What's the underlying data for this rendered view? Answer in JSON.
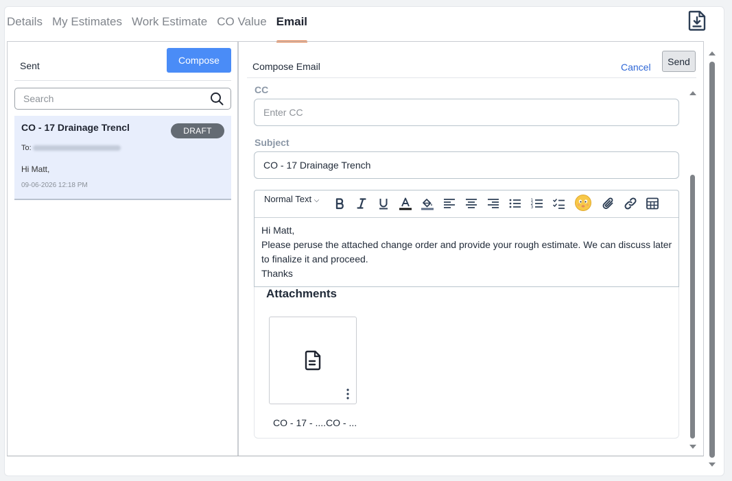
{
  "tabs": [
    {
      "label": "Details"
    },
    {
      "label": "My Estimates"
    },
    {
      "label": "Work Estimate"
    },
    {
      "label": "CO Value"
    },
    {
      "label": "Email",
      "active": true
    }
  ],
  "header": {
    "export_icon": "file-download-icon"
  },
  "left": {
    "sent_label": "Sent",
    "compose_label": "Compose",
    "search_placeholder": "Search",
    "emails": [
      {
        "subject": "CO - 17 Drainage Trencl",
        "badge": "DRAFT",
        "to_label": "To:",
        "body": "Hi Matt,",
        "date": "09-06-2026 12:18 PM"
      }
    ]
  },
  "compose": {
    "title": "Compose Email",
    "cancel_label": "Cancel",
    "send_label": "Send",
    "cc_label": "CC",
    "cc_placeholder": "Enter CC",
    "subject_label": "Subject",
    "subject_value": "CO - 17 Drainage Trench",
    "toolbar": {
      "format_label": "Normal Text",
      "items": [
        "bold-icon",
        "italic-icon",
        "underline-icon",
        "text-color-icon",
        "highlight-icon",
        "align-left-icon",
        "align-center-icon",
        "align-right-icon",
        "bullet-list-icon",
        "numbered-list-icon",
        "checklist-icon",
        "emoji-icon",
        "attach-icon",
        "link-icon",
        "table-icon"
      ]
    },
    "body_lines": [
      "Hi Matt,",
      "Please peruse the attached change order and provide your rough estimate. We can discuss later to finalize it and proceed.",
      "Thanks"
    ],
    "attachments_title": "Attachments",
    "attachments": [
      {
        "name": "CO - 17 - ....CO - ..."
      }
    ]
  },
  "colors": {
    "accent": "#4a8cf7",
    "tab_indicator": "#e0773f",
    "link": "#2f67d6",
    "badge": "#646b73"
  }
}
